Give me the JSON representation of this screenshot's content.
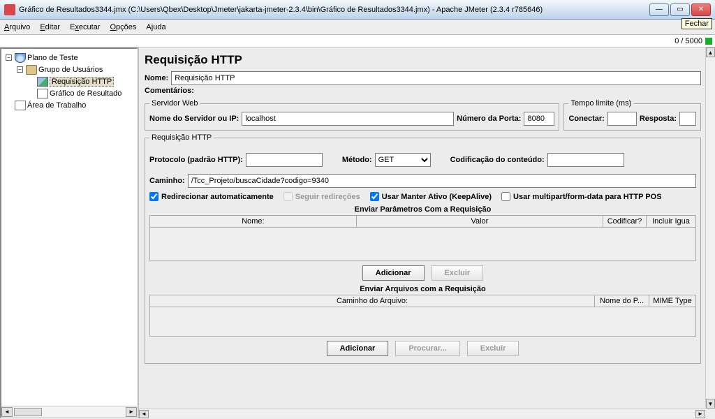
{
  "titlebar": {
    "text": "Gráfico de Resultados3344.jmx (C:\\Users\\Qbex\\Desktop\\Jmeter\\jakarta-jmeter-2.3.4\\bin\\Gráfico de Resultados3344.jmx) - Apache JMeter (2.3.4 r785646)"
  },
  "tooltip": "Fechar",
  "menu": {
    "arquivo": "Arquivo",
    "editar": "Editar",
    "executar": "Executar",
    "opcoes": "Opções",
    "ajuda": "Ajuda"
  },
  "status": {
    "counter": "0 / 5000"
  },
  "tree": {
    "plan": "Plano de Teste",
    "group": "Grupo de Usuários",
    "req": "Requisição HTTP",
    "graph": "Gráfico de Resultado",
    "workspace": "Área de Trabalho"
  },
  "main": {
    "heading": "Requisição HTTP",
    "name_lbl": "Nome:",
    "name_val": "Requisição HTTP",
    "comments_lbl": "Comentários:",
    "server_legend": "Servidor Web",
    "server_lbl": "Nome do Servidor ou IP:",
    "server_val": "localhost",
    "port_lbl": "Número da Porta:",
    "port_val": "8080",
    "timeout_legend": "Tempo limite (ms)",
    "connect_lbl": "Conectar:",
    "response_lbl": "Resposta:",
    "req_legend": "Requisição HTTP",
    "protocol_lbl": "Protocolo (padrão HTTP):",
    "method_lbl": "Método:",
    "method_val": "GET",
    "encoding_lbl": "Codificação do conteúdo:",
    "path_lbl": "Caminho:",
    "path_val": "/Tcc_Projeto/buscaCidade?codigo=9340",
    "chk_redirect_auto": "Redirecionar automaticamente",
    "chk_follow": "Seguir redireções",
    "chk_keepalive": "Usar Manter Ativo (KeepAlive)",
    "chk_multipart": "Usar multipart/form-data para HTTP POS",
    "params_title": "Enviar Parâmetros Com a Requisição",
    "col_name": "Nome:",
    "col_value": "Valor",
    "col_encode": "Codificar?",
    "col_include": "Incluir Igua",
    "btn_add": "Adicionar",
    "btn_del": "Excluir",
    "files_title": "Enviar Arquivos com a Requisição",
    "col_filepath": "Caminho do Arquivo:",
    "col_paramname": "Nome do P...",
    "col_mime": "MIME Type",
    "btn_browse": "Procurar..."
  }
}
